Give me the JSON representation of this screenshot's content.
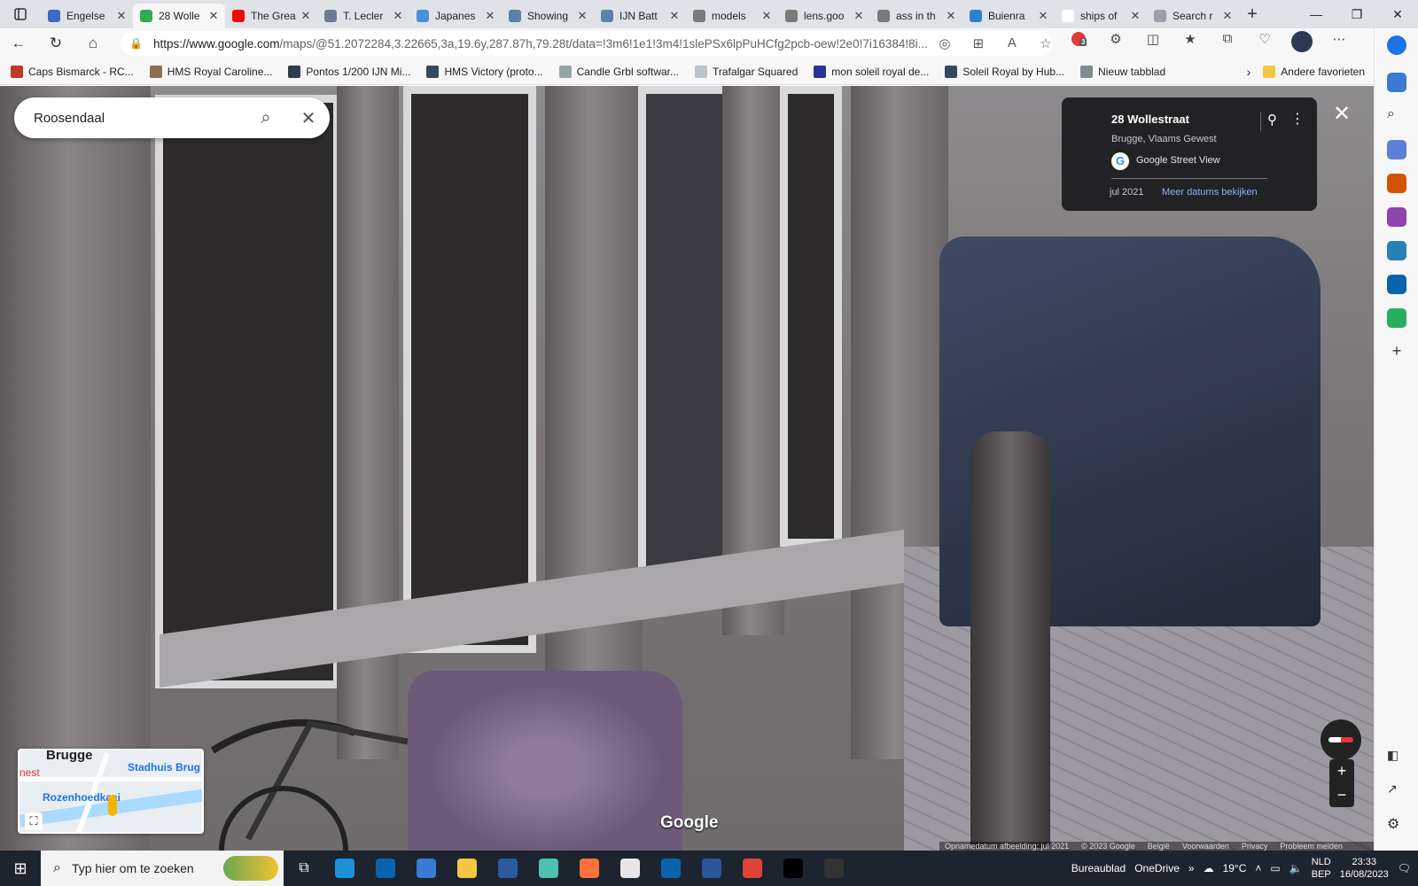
{
  "browser": {
    "tabs": [
      {
        "label": "Engelse",
        "color": "#3b6cc4",
        "active": false
      },
      {
        "label": "28 Wolle",
        "color": "#34a853",
        "active": true
      },
      {
        "label": "The Grea",
        "color": "#ff0000",
        "active": false
      },
      {
        "label": "T. Lecler",
        "color": "#6d7b8f",
        "active": false
      },
      {
        "label": "Japanes",
        "color": "#4a90d9",
        "active": false
      },
      {
        "label": "Showing",
        "color": "#5e7fa8",
        "active": false
      },
      {
        "label": "IJN Batt",
        "color": "#5e7fa8",
        "active": false
      },
      {
        "label": "models",
        "color": "#7a7a7a",
        "active": false
      },
      {
        "label": "lens.goo",
        "color": "#7a7a7a",
        "active": false
      },
      {
        "label": "ass in th",
        "color": "#7a7a7a",
        "active": false
      },
      {
        "label": "Buienra",
        "color": "#2d7fd3",
        "active": false
      },
      {
        "label": "ships of",
        "color": "#ffffff",
        "active": false
      },
      {
        "label": "Search r",
        "color": "#9aa0a6",
        "active": false
      }
    ],
    "new_tab_symbol": "+",
    "url_domain": "https://www.google.com",
    "url_path": "/maps/@51.2072284,3.22665,3a,19.6y,287.87h,79.28t/data=!3m6!1e1!3m4!1slePSx6lpPuHCfg2pcb-oew!2e0!7i16384!8i...",
    "ext_badge": "3",
    "bookmarks": [
      {
        "label": "Caps Bismarck - RC...",
        "color": "#c0392b"
      },
      {
        "label": "HMS Royal Caroline...",
        "color": "#8e6e4e"
      },
      {
        "label": "Pontos 1/200 IJN Mi...",
        "color": "#2c3e50"
      },
      {
        "label": "HMS Victory (proto...",
        "color": "#34495e"
      },
      {
        "label": "Candle Grbl softwar...",
        "color": "#95a5a6"
      },
      {
        "label": "Trafalgar Squared",
        "color": "#bdc3c7"
      },
      {
        "label": "mon soleil royal de...",
        "color": "#283593"
      },
      {
        "label": "Soleil Royal by Hub...",
        "color": "#34495e"
      },
      {
        "label": "Nieuw tabblad",
        "color": "#7f8c8d"
      }
    ],
    "bookmarks_folder": "Andere favorieten"
  },
  "maps": {
    "search_value": "Roosendaal",
    "place_title": "28 Wollestraat",
    "place_subtitle": "Brugge, Vlaams Gewest",
    "provider": "Google Street View",
    "capture_date": "jul 2021",
    "more_dates": "Meer datums bekijken",
    "watermark": "Google",
    "minimap": {
      "city": "Brugge",
      "label_1": "Stadhuis Brug",
      "label_2": "Rozenhoedkaai",
      "label_3": "nest"
    },
    "zoom_in": "+",
    "zoom_out": "−",
    "footer": [
      "Opnamedatum afbeelding: jul 2021",
      "© 2023 Google",
      "België",
      "Voorwaarden",
      "Privacy",
      "Probleem melden"
    ]
  },
  "taskbar": {
    "search_placeholder": "Typ hier om te zoeken",
    "desktop_label": "Bureaublad",
    "onedrive_label": "OneDrive",
    "temperature": "19°C",
    "lang_1": "NLD",
    "lang_2": "BEP",
    "time": "23:33",
    "date": "16/08/2023",
    "apps": [
      {
        "name": "edge",
        "color": "#1e90d6"
      },
      {
        "name": "outlook",
        "color": "#0a64ad"
      },
      {
        "name": "teams-tiles",
        "color": "#3b7bd4"
      },
      {
        "name": "explorer",
        "color": "#f2c744"
      },
      {
        "name": "ship-app",
        "color": "#2c5aa0"
      },
      {
        "name": "loop",
        "color": "#4dc1b1"
      },
      {
        "name": "firefox",
        "color": "#ff7139"
      },
      {
        "name": "notes",
        "color": "#e6e6e6"
      },
      {
        "name": "outlook-2",
        "color": "#0a64ad"
      },
      {
        "name": "word",
        "color": "#2b579a"
      },
      {
        "name": "chrome",
        "color": "#db4437"
      },
      {
        "name": "inkscape",
        "color": "#000000"
      },
      {
        "name": "rhino",
        "color": "#333333"
      }
    ]
  }
}
